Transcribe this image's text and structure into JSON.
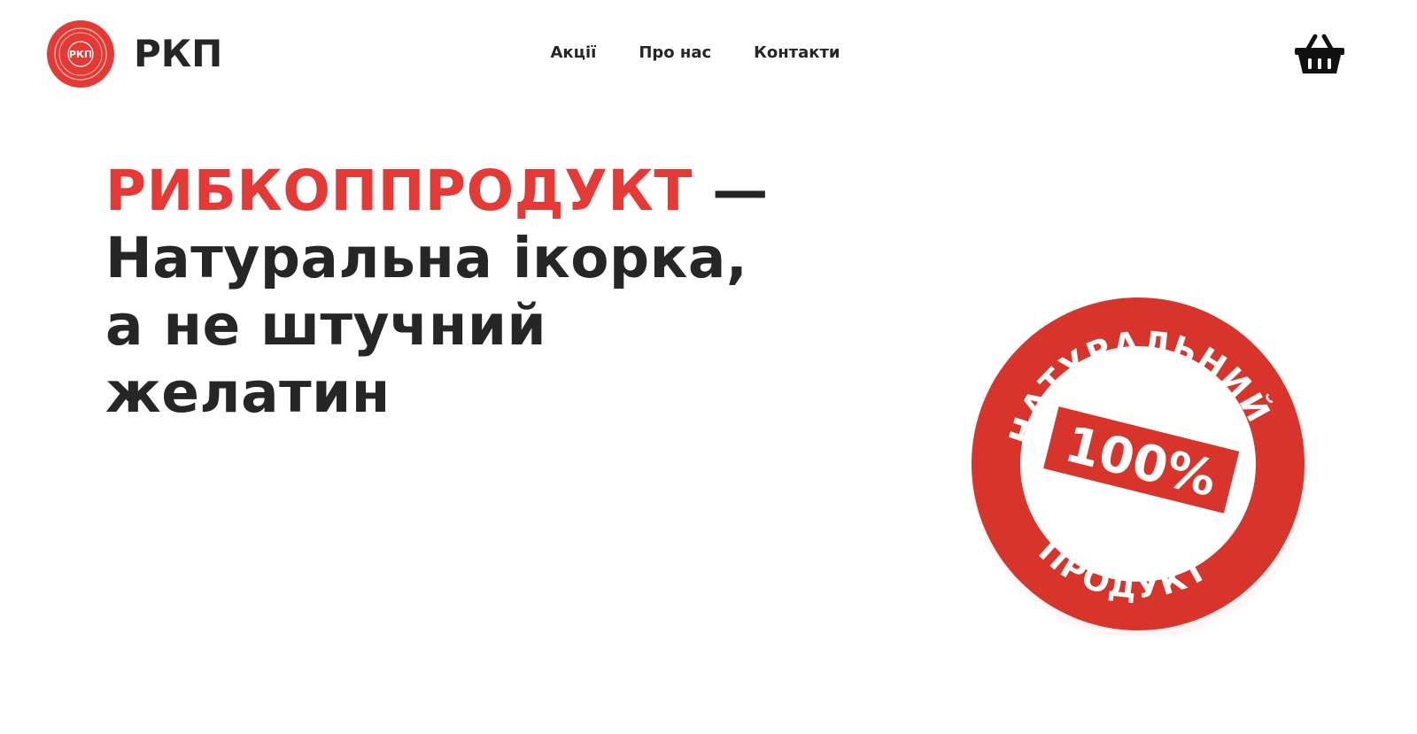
{
  "header": {
    "logo_text": "РКП",
    "logo_badge_text": "РКП",
    "nav": [
      {
        "label": "Акції"
      },
      {
        "label": "Про нас"
      },
      {
        "label": "Контакти"
      }
    ],
    "cart_icon": "basket-icon"
  },
  "hero": {
    "brand": "РИБКОППРОДУКТ",
    "dash": " —",
    "line2": "Натуральна ікорка,",
    "line3": "а не штучний",
    "line4": "желатин"
  },
  "stamp": {
    "top_text": "НАТУРАЛЬНИЙ",
    "center_text": "100%",
    "bottom_text": "ПРОДУКТ"
  },
  "colors": {
    "accent": "#e53935",
    "stamp_red": "#d7352b",
    "text": "#262626"
  }
}
